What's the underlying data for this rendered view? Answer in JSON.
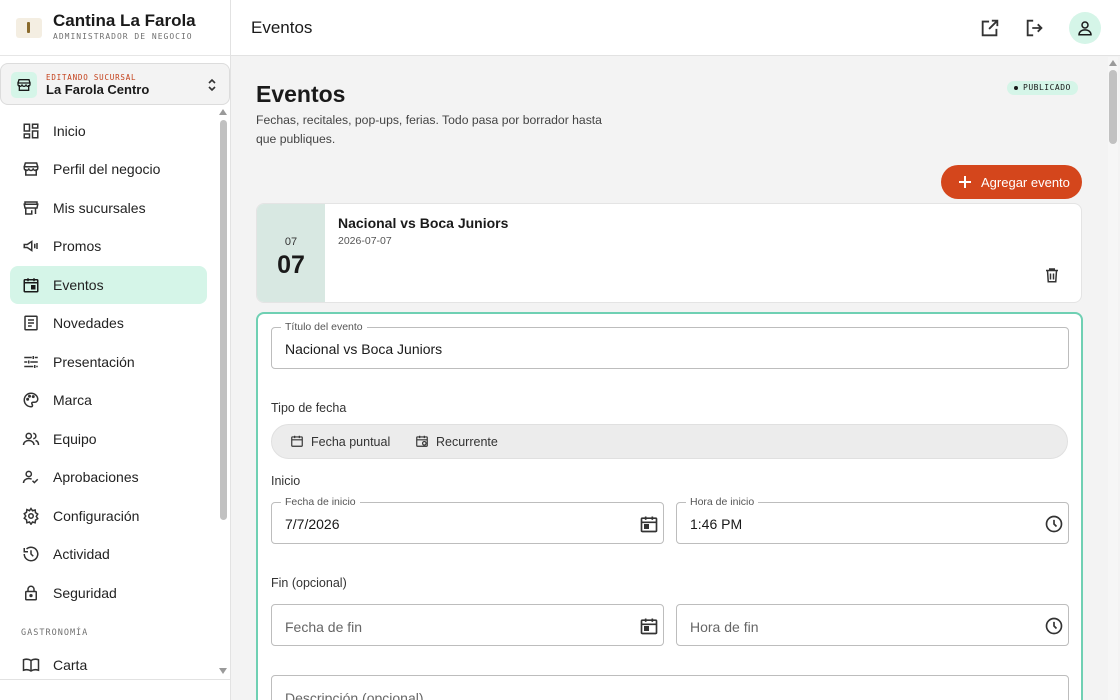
{
  "brand": {
    "name": "Cantina La Farola",
    "subtitle": "ADMINISTRADOR DE NEGOCIO"
  },
  "branch_selector": {
    "kicker": "EDITANDO SUCURSAL",
    "name": "La Farola Centro"
  },
  "sidebar": {
    "items": [
      {
        "label": "Inicio",
        "icon": "dashboard-icon"
      },
      {
        "label": "Perfil del negocio",
        "icon": "storefront-icon"
      },
      {
        "label": "Mis sucursales",
        "icon": "store-icon"
      },
      {
        "label": "Promos",
        "icon": "megaphone-icon"
      },
      {
        "label": "Eventos",
        "icon": "calendar-event-icon",
        "active": true
      },
      {
        "label": "Novedades",
        "icon": "article-icon"
      },
      {
        "label": "Presentación",
        "icon": "tune-icon"
      },
      {
        "label": "Marca",
        "icon": "palette-icon"
      },
      {
        "label": "Equipo",
        "icon": "people-icon"
      },
      {
        "label": "Aprobaciones",
        "icon": "person-check-icon"
      },
      {
        "label": "Configuración",
        "icon": "gear-icon"
      },
      {
        "label": "Actividad",
        "icon": "history-icon"
      },
      {
        "label": "Seguridad",
        "icon": "lock-icon"
      }
    ],
    "section_gastronomia": "GASTRONOMÍA",
    "section_items": [
      {
        "label": "Carta",
        "icon": "menu-book-icon"
      }
    ]
  },
  "topbar": {
    "title": "Eventos",
    "actions": [
      "open-external-icon",
      "logout-icon",
      "account-icon"
    ]
  },
  "page": {
    "title": "Eventos",
    "description": "Fechas, recitales, pop-ups, ferias. Todo pasa por borrador hasta que publiques.",
    "status": "PUBLICADO",
    "add_button": "Agregar evento"
  },
  "event": {
    "month": "07",
    "day": "07",
    "title": "Nacional vs Boca Juniors",
    "date": "2026-07-07"
  },
  "form": {
    "title_label": "Título del evento",
    "title_value": "Nacional vs Boca Juniors",
    "date_type_label": "Tipo de fecha",
    "date_type_options": [
      "Fecha puntual",
      "Recurrente"
    ],
    "start_section": "Inicio",
    "start_date_label": "Fecha de inicio",
    "start_date_value": "7/7/2026",
    "start_time_label": "Hora de inicio",
    "start_time_value": "1:46 PM",
    "end_section": "Fin (opcional)",
    "end_date_placeholder": "Fecha de fin",
    "end_time_placeholder": "Hora de fin",
    "description_placeholder": "Descripción (opcional)"
  },
  "colors": {
    "accent": "#d4461c",
    "active_bg": "#d5f5e8",
    "focus_border": "#6fd0b3"
  }
}
